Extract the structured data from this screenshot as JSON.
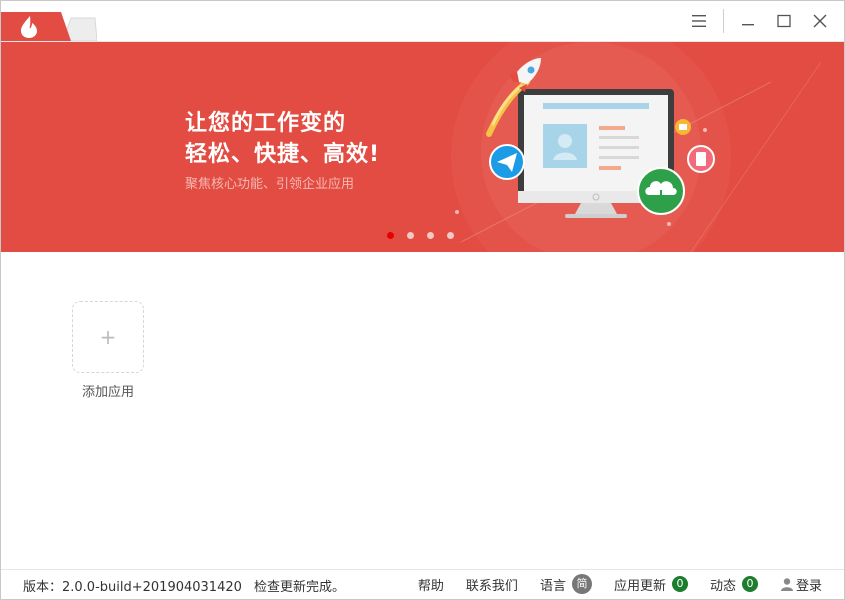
{
  "banner": {
    "headline_line1": "让您的工作变的",
    "headline_line2": "轻松、快捷、高效!",
    "subline": "聚焦核心功能、引领企业应用",
    "slides": [
      {
        "active": true
      },
      {
        "active": false
      },
      {
        "active": false
      },
      {
        "active": false
      }
    ],
    "colors": {
      "background": "#e24c42",
      "active_dot": "#e60000"
    }
  },
  "apps": {
    "add_symbol": "+",
    "add_label": "添加应用"
  },
  "statusbar": {
    "version": "版本：2.0.0-build+201904031420",
    "update_status": "检查更新完成。",
    "help": "帮助",
    "contact": "联系我们",
    "language": "语言",
    "language_badge": "简",
    "app_update": "应用更新",
    "app_update_count": "0",
    "news": "动态",
    "news_count": "0",
    "login": "登录"
  },
  "icons": {
    "app_logo": "flame-icon",
    "menu": "hamburger-menu-icon",
    "minimize": "minimize-icon",
    "maximize": "maximize-icon",
    "close": "close-icon",
    "user": "user-icon"
  }
}
